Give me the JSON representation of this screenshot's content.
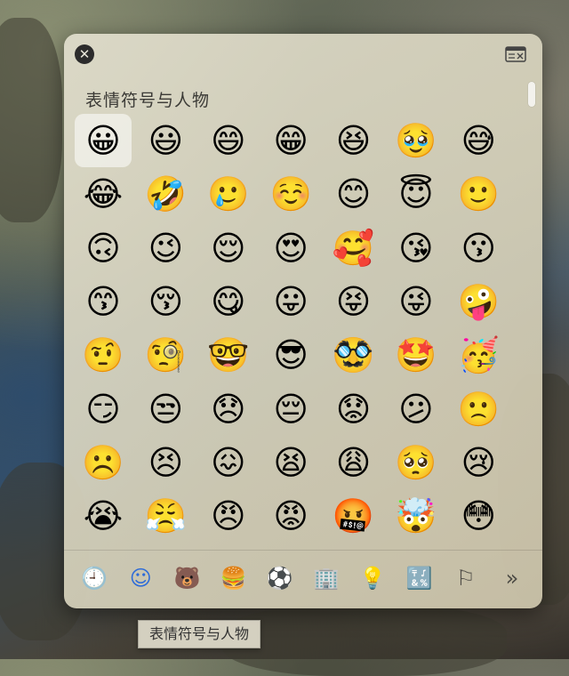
{
  "picker": {
    "section_title": "表情符号与人物",
    "close_label": "✕",
    "emoji_rows": [
      [
        "😀",
        "😃",
        "😄",
        "😁",
        "😆",
        "🥹",
        "😅"
      ],
      [
        "😂",
        "🤣",
        "🥲",
        "☺️",
        "😊",
        "😇",
        "🙂"
      ],
      [
        "🙃",
        "😉",
        "😌",
        "😍",
        "🥰",
        "😘",
        "😗"
      ],
      [
        "😙",
        "😚",
        "😋",
        "😛",
        "😝",
        "😜",
        "🤪"
      ],
      [
        "🤨",
        "🧐",
        "🤓",
        "😎",
        "🥸",
        "🤩",
        "🥳"
      ],
      [
        "😏",
        "😒",
        "😞",
        "😔",
        "😟",
        "😕",
        "🙁"
      ],
      [
        "☹️",
        "😣",
        "😖",
        "😫",
        "😩",
        "🥺",
        "😢"
      ],
      [
        "😭",
        "😤",
        "😠",
        "😡",
        "🤬",
        "🤯",
        "😳"
      ]
    ],
    "selected": "😀",
    "categories": [
      {
        "icon": "clock-icon",
        "glyph": "🕘"
      },
      {
        "icon": "smiley-icon",
        "glyph": "☺"
      },
      {
        "icon": "bear-icon",
        "glyph": "🐻"
      },
      {
        "icon": "food-icon",
        "glyph": "🍔"
      },
      {
        "icon": "soccer-ball-icon",
        "glyph": "⚽"
      },
      {
        "icon": "building-icon",
        "glyph": "🏢"
      },
      {
        "icon": "lightbulb-icon",
        "glyph": "💡"
      },
      {
        "icon": "symbols-icon",
        "glyph": "🔣"
      },
      {
        "icon": "flag-icon",
        "glyph": "⚐"
      },
      {
        "icon": "more-icon",
        "glyph": "»"
      }
    ],
    "tooltip": "表情符号与人物"
  }
}
